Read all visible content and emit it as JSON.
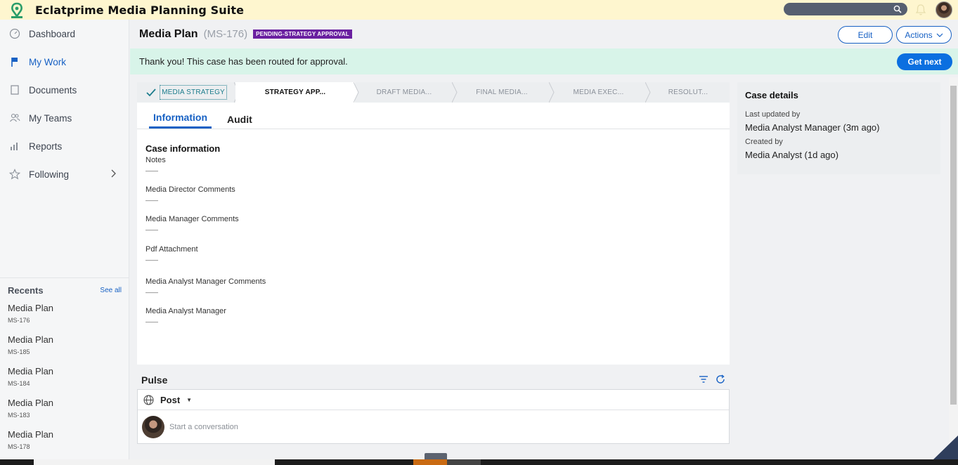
{
  "app": {
    "title": "Eclatprime Media Planning Suite"
  },
  "sidebar": {
    "items": [
      {
        "label": "Dashboard",
        "icon": "dashboard-icon"
      },
      {
        "label": "My Work",
        "icon": "flag-icon"
      },
      {
        "label": "Documents",
        "icon": "document-icon"
      },
      {
        "label": "My Teams",
        "icon": "teams-icon"
      },
      {
        "label": "Reports",
        "icon": "bar-chart-icon"
      },
      {
        "label": "Following",
        "icon": "star-icon"
      }
    ],
    "recents_title": "Recents",
    "see_all": "See all",
    "recents": [
      {
        "title": "Media Plan",
        "id": "MS-176"
      },
      {
        "title": "Media Plan",
        "id": "MS-185"
      },
      {
        "title": "Media Plan",
        "id": "MS-184"
      },
      {
        "title": "Media Plan",
        "id": "MS-183"
      },
      {
        "title": "Media Plan",
        "id": "MS-178"
      }
    ]
  },
  "header": {
    "title": "Media Plan",
    "case_id": "(MS-176)",
    "status": "PENDING-STRATEGY APPROVAL",
    "edit_label": "Edit",
    "actions_label": "Actions"
  },
  "banner": {
    "message": "Thank you! This case has been routed for approval.",
    "get_next_label": "Get next"
  },
  "stages": [
    {
      "label": "MEDIA STRATEGY",
      "state": "done"
    },
    {
      "label": "STRATEGY APP...",
      "state": "current"
    },
    {
      "label": "DRAFT MEDIA...",
      "state": "future"
    },
    {
      "label": "FINAL MEDIA...",
      "state": "future"
    },
    {
      "label": "MEDIA EXEC...",
      "state": "future"
    },
    {
      "label": "RESOLUT...",
      "state": "future"
    }
  ],
  "tabs": [
    {
      "label": "Information"
    },
    {
      "label": "Audit"
    }
  ],
  "case_info": {
    "title": "Case information",
    "fields": [
      {
        "label": "Notes",
        "value": "——"
      },
      {
        "label": "Media Director Comments",
        "value": "——"
      },
      {
        "label": "Media Manager Comments",
        "value": "——"
      },
      {
        "label": "Pdf Attachment",
        "value": "——"
      },
      {
        "label": "Media Analyst Manager Comments",
        "value": "——"
      },
      {
        "label": "Media Analyst Manager",
        "value": "——"
      }
    ]
  },
  "pulse": {
    "title": "Pulse",
    "post_label": "Post",
    "placeholder": "Start a conversation"
  },
  "case_details": {
    "title": "Case details",
    "last_updated_label": "Last updated by",
    "last_updated_value": "Media Analyst Manager (3m ago)",
    "created_label": "Created by",
    "created_value": "Media Analyst (1d ago)"
  },
  "colors": {
    "topbar": "#fef6cf",
    "accent": "#1761c4",
    "banner": "#d8f4e9",
    "status_badge": "#6a1fa0"
  }
}
